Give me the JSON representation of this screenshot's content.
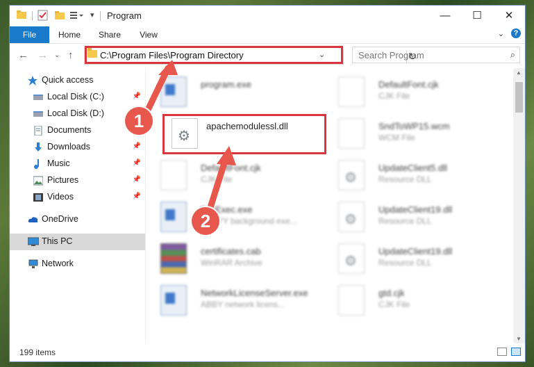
{
  "window": {
    "title": "Program"
  },
  "ribbon": {
    "tabs": [
      "File",
      "Home",
      "Share",
      "View"
    ]
  },
  "address": {
    "path": "C:\\Program Files\\Program Directory"
  },
  "search": {
    "placeholder": "Search Program"
  },
  "nav": {
    "items": [
      {
        "label": "Quick access",
        "icon": "star-icon",
        "pinned": false
      },
      {
        "label": "Local Disk (C:)",
        "icon": "drive-icon",
        "pinned": true
      },
      {
        "label": "Local Disk (D:)",
        "icon": "drive-icon",
        "pinned": false
      },
      {
        "label": "Documents",
        "icon": "documents-icon",
        "pinned": false
      },
      {
        "label": "Downloads",
        "icon": "download-icon",
        "pinned": true
      },
      {
        "label": "Music",
        "icon": "music-icon",
        "pinned": true
      },
      {
        "label": "Pictures",
        "icon": "pictures-icon",
        "pinned": true
      },
      {
        "label": "Videos",
        "icon": "videos-icon",
        "pinned": true
      },
      {
        "label": "OneDrive",
        "icon": "cloud-icon",
        "pinned": false
      },
      {
        "label": "This PC",
        "icon": "pc-icon",
        "pinned": false,
        "selected": true
      },
      {
        "label": "Network",
        "icon": "network-icon",
        "pinned": false
      }
    ]
  },
  "files": {
    "left": [
      {
        "name": "program.exe",
        "type": "",
        "icon": "exe-icon"
      },
      {
        "name": "apachemodulessl.dll",
        "type": "",
        "icon": "gear-icon",
        "highlighted": true
      },
      {
        "name": "DefaultFont.cjk",
        "type": "CJK File",
        "icon": "doc-icon"
      },
      {
        "name": "FileExec.exe",
        "type": "ABBYY background exe...",
        "icon": "exe-icon"
      },
      {
        "name": "certificates.cab",
        "type": "WinRAR Archive",
        "icon": "rar-icon"
      },
      {
        "name": "NetworkLicenseServer.exe",
        "type": "ABBY network licens...",
        "icon": "exe-icon"
      }
    ],
    "right": [
      {
        "name": "DefaultFont.cjk",
        "type": "CJK File",
        "icon": "doc-icon"
      },
      {
        "name": "SndToWP15.wcm",
        "type": "WCM File",
        "icon": "doc-icon"
      },
      {
        "name": "UpdateClient5.dll",
        "type": "Resource DLL",
        "icon": "gear-icon"
      },
      {
        "name": "UpdateClient19.dll",
        "type": "Resource DLL",
        "icon": "gear-icon"
      },
      {
        "name": "UpdateClient19.dll",
        "type": "Resource DLL",
        "icon": "gear-icon"
      },
      {
        "name": "gtd.cjk",
        "type": "CJK File",
        "icon": "doc-icon"
      }
    ]
  },
  "status": {
    "items": "199 items"
  },
  "annotations": {
    "badge1": "1",
    "badge2": "2"
  },
  "colors": {
    "accent": "#1979ca",
    "highlight": "#d9363e",
    "badge": "#e8574c"
  }
}
